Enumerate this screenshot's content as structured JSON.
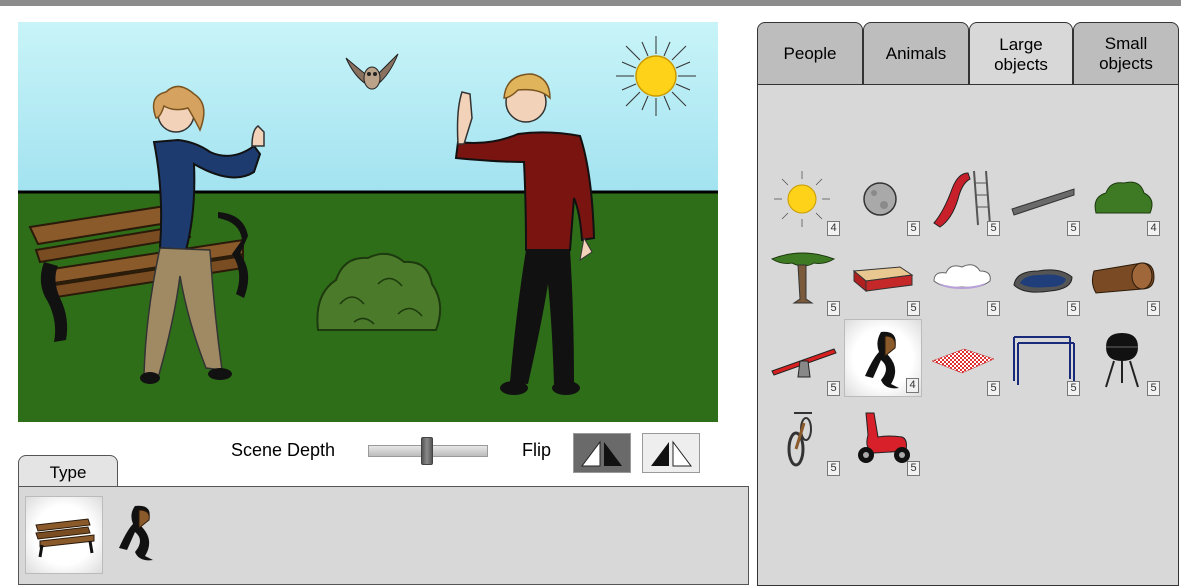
{
  "controls": {
    "scene_depth_label": "Scene Depth",
    "flip_label": "Flip",
    "scene_depth_value": 0.5
  },
  "type_panel": {
    "tab_label": "Type",
    "items": [
      {
        "icon": "park-bench-icon",
        "selected": true
      },
      {
        "icon": "bench-end-icon",
        "selected": false
      }
    ]
  },
  "tabs": [
    {
      "label": "People",
      "active": false
    },
    {
      "label": "Animals",
      "active": false
    },
    {
      "label": "Large objects",
      "active": true
    },
    {
      "label": "Small objects",
      "active": false
    }
  ],
  "library": [
    {
      "icon": "sun-icon",
      "count": "4"
    },
    {
      "icon": "moon-icon",
      "count": "5"
    },
    {
      "icon": "slide-icon",
      "count": "5"
    },
    {
      "icon": "ramp-icon",
      "count": "5"
    },
    {
      "icon": "bush-icon",
      "count": "4"
    },
    {
      "icon": "tree-icon",
      "count": "5"
    },
    {
      "icon": "sandbox-icon",
      "count": "5"
    },
    {
      "icon": "cloud-icon",
      "count": "5"
    },
    {
      "icon": "pond-icon",
      "count": "5"
    },
    {
      "icon": "log-icon",
      "count": "5"
    },
    {
      "icon": "seesaw-icon",
      "count": "5"
    },
    {
      "icon": "bench-icon",
      "count": "4",
      "selected": true
    },
    {
      "icon": "picnic-blanket-icon",
      "count": "5"
    },
    {
      "icon": "monkey-bars-icon",
      "count": "5"
    },
    {
      "icon": "grill-icon",
      "count": "5"
    },
    {
      "icon": "bicycle-icon",
      "count": "5"
    },
    {
      "icon": "scooter-icon",
      "count": "5"
    }
  ],
  "colors": {
    "sky_top": "#c5f3f8",
    "sky_bottom": "#a4e4f2",
    "grass": "#2f6e18",
    "sun": "#ffd21a",
    "panel_bg": "#d8d8d8",
    "tab_bg": "#bdbdbd"
  }
}
